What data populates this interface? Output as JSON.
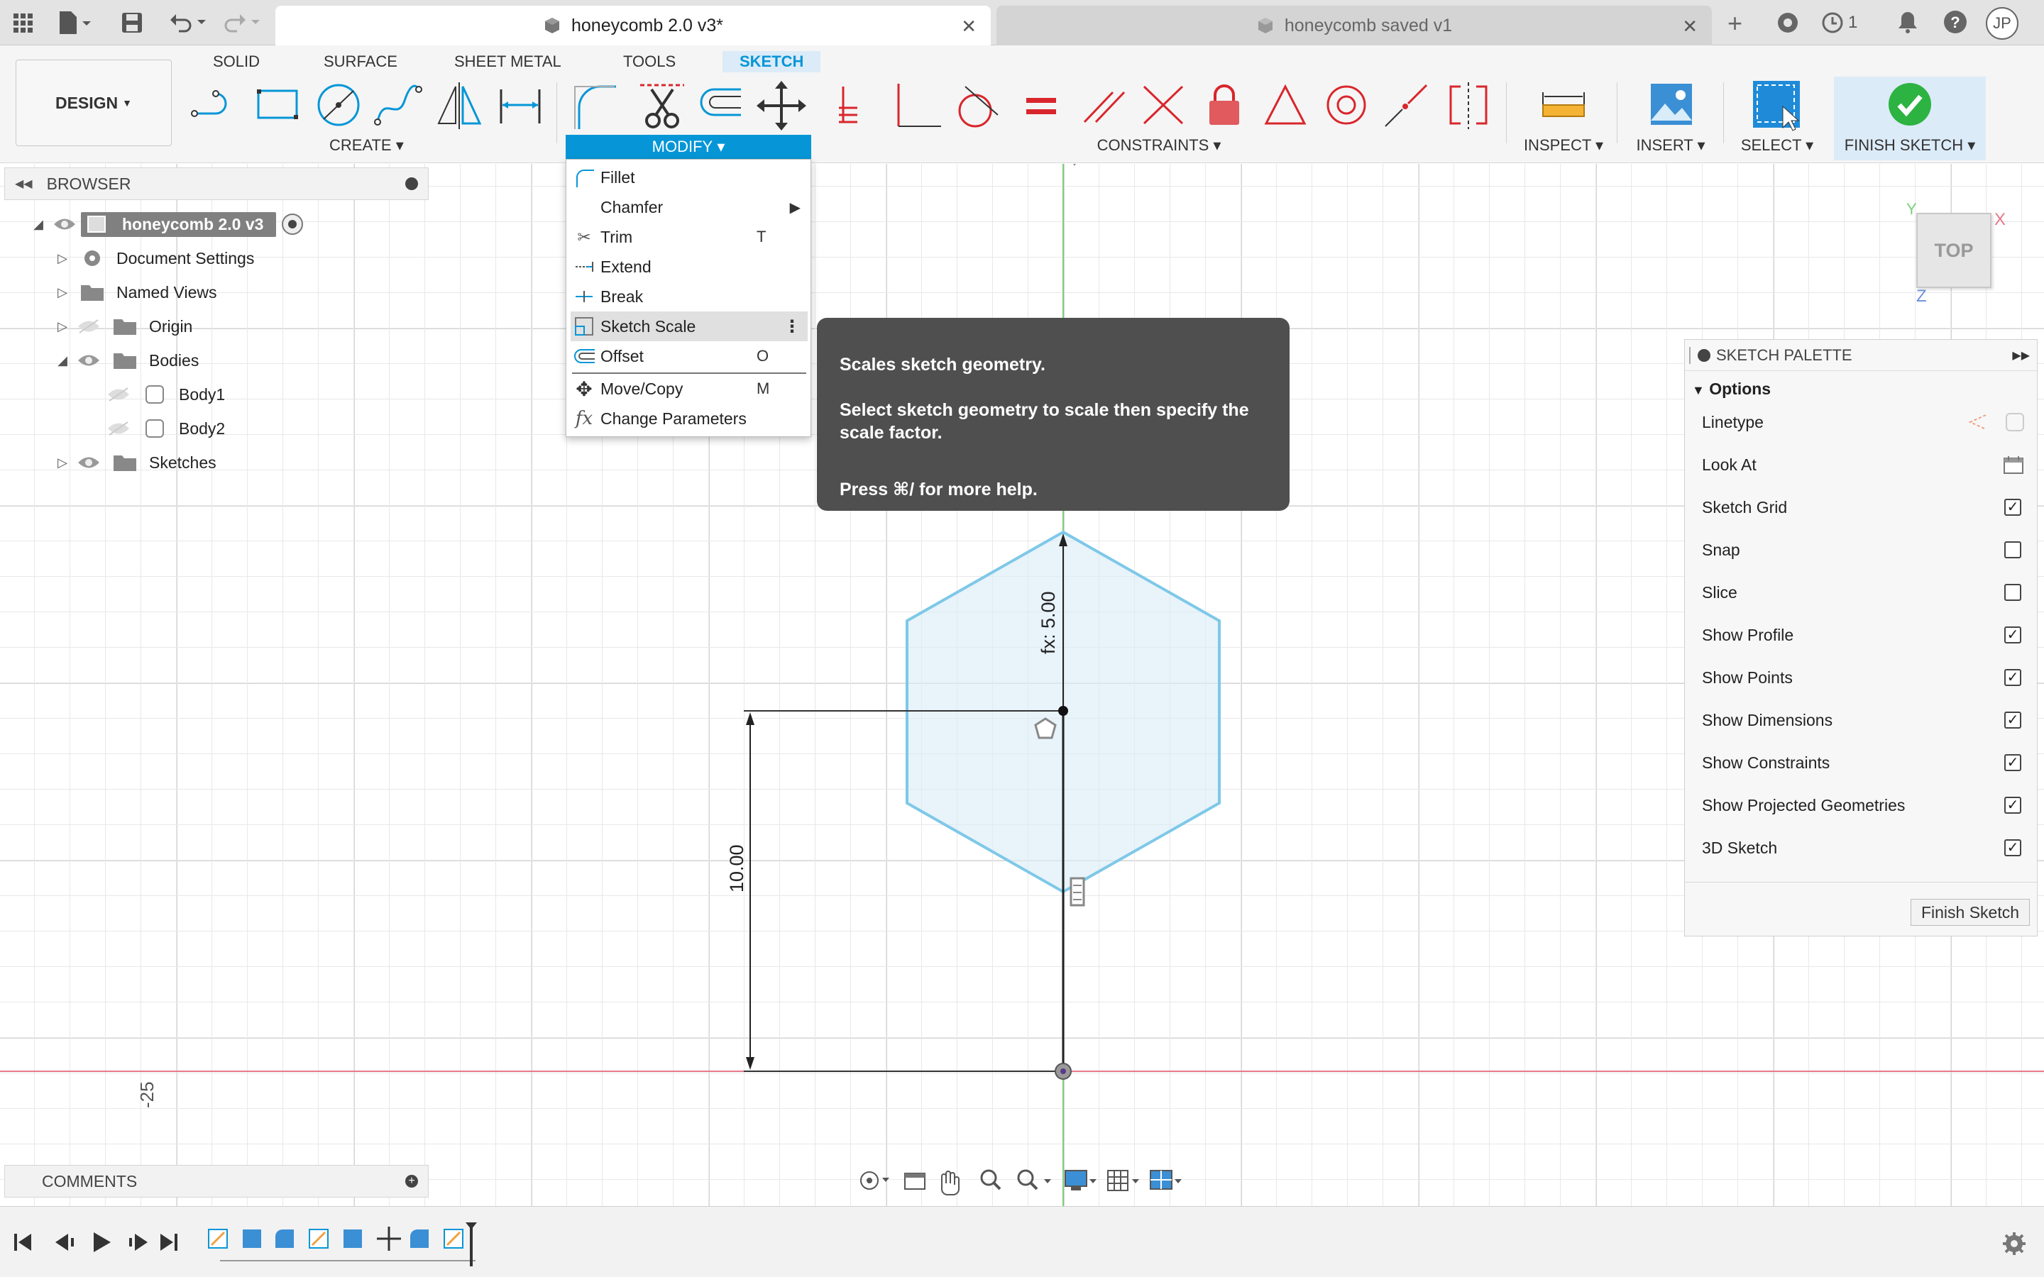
{
  "titlebar": {
    "active_tab": "honeycomb 2.0 v3*",
    "inactive_tab": "honeycomb saved v1",
    "job_count": "1",
    "user_initials": "JP"
  },
  "ribbon": {
    "workspace": "DESIGN",
    "tabs": [
      "SOLID",
      "SURFACE",
      "SHEET METAL",
      "TOOLS",
      "SKETCH"
    ],
    "groups": {
      "create": "CREATE",
      "modify": "MODIFY",
      "constraints": "CONSTRAINTS",
      "inspect": "INSPECT",
      "insert": "INSERT",
      "select": "SELECT",
      "finish": "FINISH SKETCH"
    }
  },
  "browser": {
    "title": "BROWSER",
    "root": "honeycomb 2.0 v3",
    "items": [
      "Document Settings",
      "Named Views",
      "Origin",
      "Bodies",
      "Body1",
      "Body2",
      "Sketches"
    ]
  },
  "comments": {
    "title": "COMMENTS"
  },
  "modify_menu": {
    "items": [
      {
        "label": "Fillet",
        "key": ""
      },
      {
        "label": "Chamfer",
        "key": ""
      },
      {
        "label": "Trim",
        "key": "T"
      },
      {
        "label": "Extend",
        "key": ""
      },
      {
        "label": "Break",
        "key": ""
      },
      {
        "label": "Sketch Scale",
        "key": ""
      },
      {
        "label": "Offset",
        "key": "O"
      },
      {
        "label": "Move/Copy",
        "key": "M"
      },
      {
        "label": "Change Parameters",
        "key": ""
      }
    ]
  },
  "tooltip": {
    "line1": "Scales sketch geometry.",
    "line2": "Select sketch geometry to scale then specify the scale factor.",
    "line3": "Press ⌘/ for more help."
  },
  "viewcube": {
    "face": "TOP",
    "x": "X",
    "y": "Y",
    "z": "Z"
  },
  "sketch": {
    "dim_vertical": "10.00",
    "dim_hex": "fx: 5.00",
    "axis_label": "-25"
  },
  "palette": {
    "title": "SKETCH PALETTE",
    "section": "Options",
    "rows": [
      {
        "label": "Linetype",
        "checked": null
      },
      {
        "label": "Look At",
        "checked": null
      },
      {
        "label": "Sketch Grid",
        "checked": true
      },
      {
        "label": "Snap",
        "checked": false
      },
      {
        "label": "Slice",
        "checked": false
      },
      {
        "label": "Show Profile",
        "checked": true
      },
      {
        "label": "Show Points",
        "checked": true
      },
      {
        "label": "Show Dimensions",
        "checked": true
      },
      {
        "label": "Show Constraints",
        "checked": true
      },
      {
        "label": "Show Projected Geometries",
        "checked": true
      },
      {
        "label": "3D Sketch",
        "checked": true
      }
    ],
    "finish_button": "Finish Sketch"
  },
  "colors": {
    "accent": "#0696d7",
    "constraint_red": "#d9262c",
    "finish_green": "#2db341",
    "sketch_blue": "#7ec8e8"
  }
}
